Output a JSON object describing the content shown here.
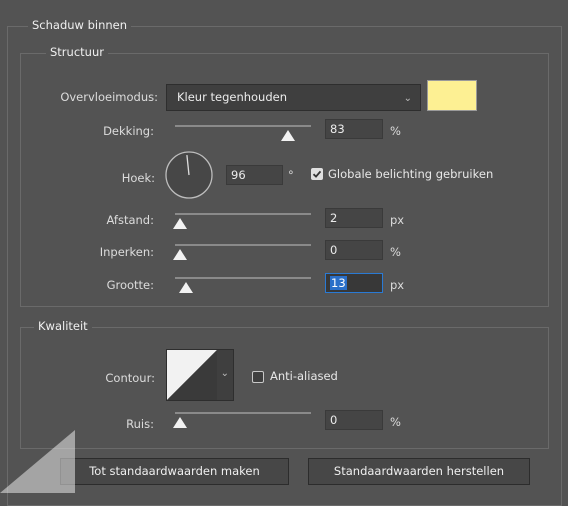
{
  "panel": {
    "title": "Schaduw binnen"
  },
  "structure": {
    "title": "Structuur",
    "blend_mode": {
      "label": "Overvloeimodus:",
      "value": "Kleur tegenhouden",
      "swatch_color": "#fdf093"
    },
    "opacity": {
      "label": "Dekking:",
      "value": "83",
      "unit": "%",
      "slider_fraction": 0.83
    },
    "angle": {
      "label": "Hoek:",
      "value": "96",
      "unit": "°",
      "dial_degrees": 96
    },
    "global_light": {
      "label": "Globale belichting gebruiken",
      "checked": true
    },
    "distance": {
      "label": "Afstand:",
      "value": "2",
      "unit": "px",
      "slider_fraction": 0.02
    },
    "choke": {
      "label": "Inperken:",
      "value": "0",
      "unit": "%",
      "slider_fraction": 0.0
    },
    "size": {
      "label": "Grootte:",
      "value": "13",
      "unit": "px",
      "slider_fraction": 0.08
    }
  },
  "quality": {
    "title": "Kwaliteit",
    "contour": {
      "label": "Contour:"
    },
    "anti_aliased": {
      "label": "Anti-aliased",
      "checked": false
    },
    "noise": {
      "label": "Ruis:",
      "value": "0",
      "unit": "%",
      "slider_fraction": 0.0
    }
  },
  "buttons": {
    "make_default": "Tot standaardwaarden maken",
    "reset_default": "Standaardwaarden herstellen"
  },
  "colors": {
    "accent": "#2a7ad4",
    "checkbox_checked": "#e0e0e0"
  }
}
